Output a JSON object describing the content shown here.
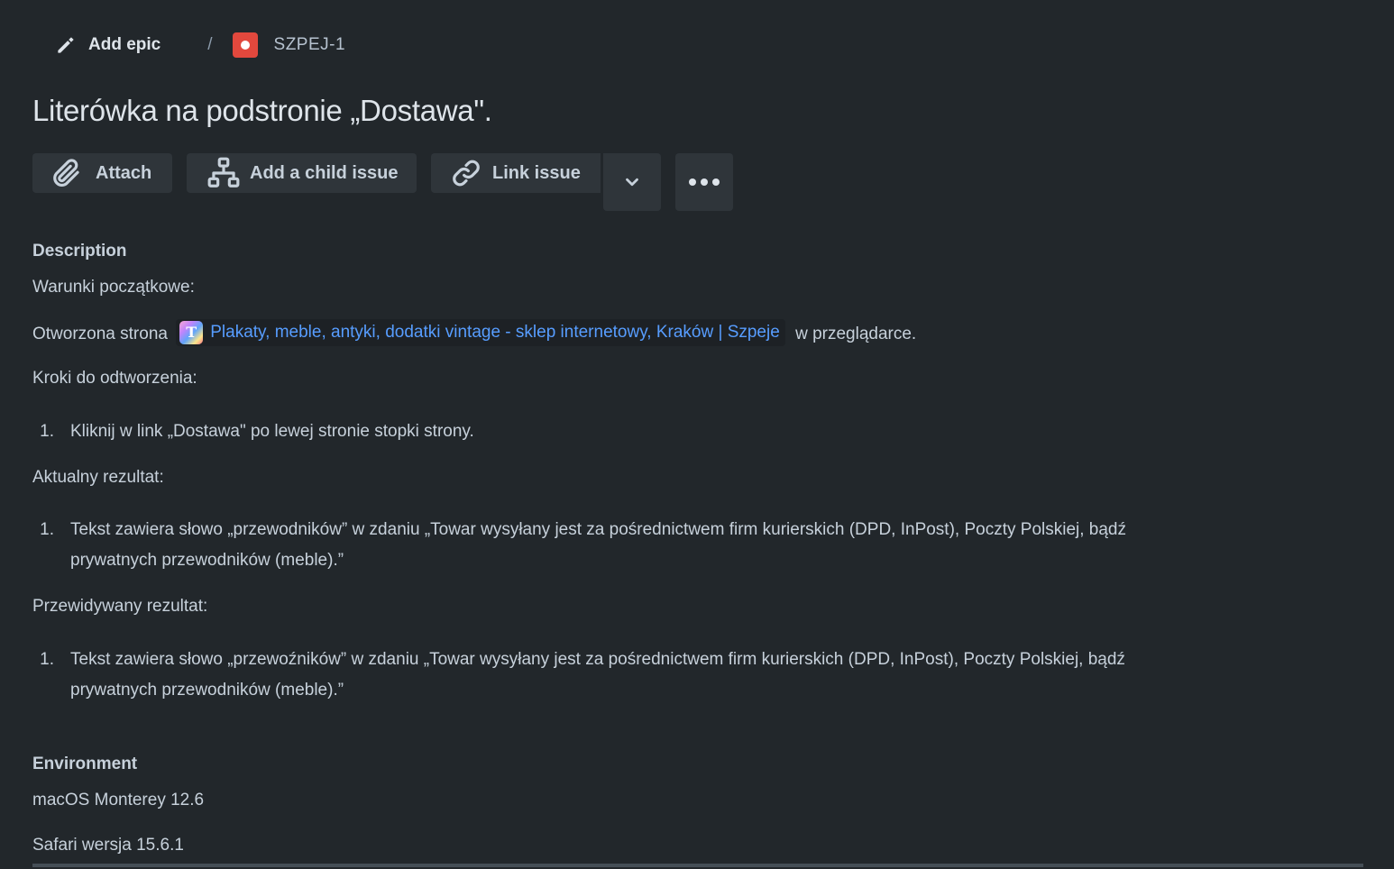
{
  "breadcrumb": {
    "epic_label": "Add epic",
    "separator": "/",
    "issue_key": "SZPEJ-1"
  },
  "issue": {
    "title": "Literówka na podstronie „Dostawa\"."
  },
  "toolbar": {
    "attach_label": "Attach",
    "child_label": "Add a child issue",
    "link_label": "Link issue"
  },
  "description": {
    "heading": "Description",
    "preconditions_label": "Warunki początkowe:",
    "opened_prefix": "Otworzona strona",
    "link_favicon_letter": "T",
    "link_text": "Plakaty, meble, antyki, dodatki vintage - sklep internetowy, Kraków | Szpeje",
    "opened_suffix": "w przeglądarce.",
    "steps_label": "Kroki do odtworzenia:",
    "steps": [
      {
        "num": "1.",
        "text": "Kliknij w link „Dostawa\" po lewej stronie stopki strony."
      }
    ],
    "actual_label": "Aktualny rezultat:",
    "actual": [
      {
        "num": "1.",
        "line1": "Tekst zawiera słowo „przewodników” w zdaniu  „Towar wysyłany jest za pośrednictwem firm kurierskich (DPD, InPost), Poczty Polskiej, bądź",
        "line2": "prywatnych przewodników (meble).”"
      }
    ],
    "expected_label": "Przewidywany rezultat:",
    "expected": [
      {
        "num": "1.",
        "line1": "Tekst zawiera słowo „przewoźników” w zdaniu  „Towar wysyłany jest za pośrednictwem firm kurierskich (DPD, InPost), Poczty Polskiej, bądź",
        "line2": "prywatnych przewodników (meble).”"
      }
    ]
  },
  "environment": {
    "heading": "Environment",
    "os": "macOS Monterey 12.6",
    "browser": "Safari wersja 15.6.1"
  },
  "colors": {
    "background": "#22272b",
    "text": "#c7d1db",
    "link": "#579dff",
    "bug": "#e2483d",
    "button_bg": "#2f353a"
  }
}
